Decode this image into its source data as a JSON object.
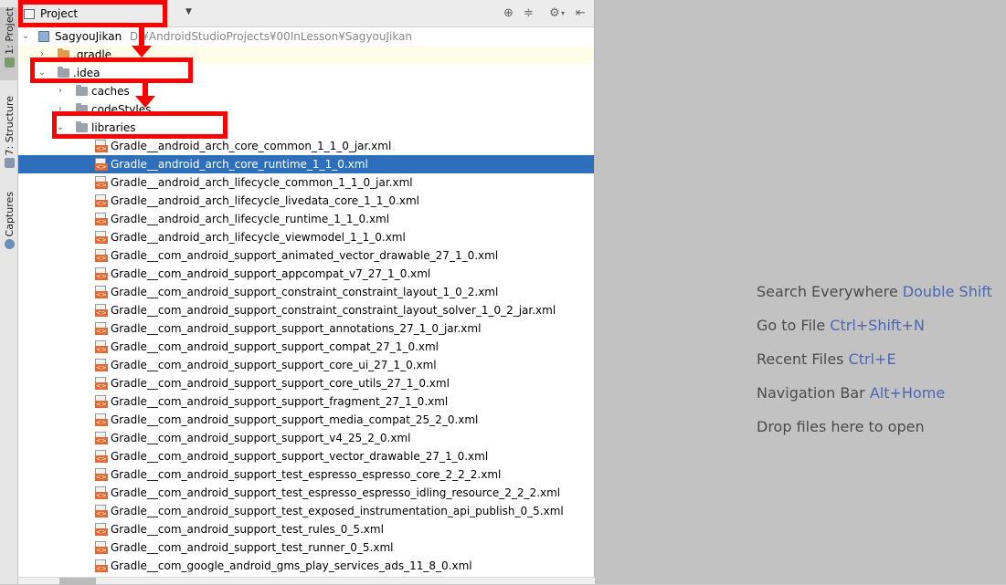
{
  "sidebar_tabs": [
    {
      "label": "1: Project"
    },
    {
      "label": "7: Structure"
    },
    {
      "label": "Captures"
    }
  ],
  "toolbar": {
    "view_label": "Project"
  },
  "tree": {
    "root": {
      "name": "SagyouJikan",
      "path": "D:¥AndroidStudioProjects¥00InLesson¥SagyouJikan"
    },
    "gradle": ".gradle",
    "idea": ".idea",
    "caches": "caches",
    "codestyles": "codeStyles",
    "libraries": "libraries",
    "files": [
      "Gradle__android_arch_core_common_1_1_0_jar.xml",
      "Gradle__android_arch_core_runtime_1_1_0.xml",
      "Gradle__android_arch_lifecycle_common_1_1_0_jar.xml",
      "Gradle__android_arch_lifecycle_livedata_core_1_1_0.xml",
      "Gradle__android_arch_lifecycle_runtime_1_1_0.xml",
      "Gradle__android_arch_lifecycle_viewmodel_1_1_0.xml",
      "Gradle__com_android_support_animated_vector_drawable_27_1_0.xml",
      "Gradle__com_android_support_appcompat_v7_27_1_0.xml",
      "Gradle__com_android_support_constraint_constraint_layout_1_0_2.xml",
      "Gradle__com_android_support_constraint_constraint_layout_solver_1_0_2_jar.xml",
      "Gradle__com_android_support_support_annotations_27_1_0_jar.xml",
      "Gradle__com_android_support_support_compat_27_1_0.xml",
      "Gradle__com_android_support_support_core_ui_27_1_0.xml",
      "Gradle__com_android_support_support_core_utils_27_1_0.xml",
      "Gradle__com_android_support_support_fragment_27_1_0.xml",
      "Gradle__com_android_support_support_media_compat_25_2_0.xml",
      "Gradle__com_android_support_support_v4_25_2_0.xml",
      "Gradle__com_android_support_support_vector_drawable_27_1_0.xml",
      "Gradle__com_android_support_test_espresso_espresso_core_2_2_2.xml",
      "Gradle__com_android_support_test_espresso_espresso_idling_resource_2_2_2.xml",
      "Gradle__com_android_support_test_exposed_instrumentation_api_publish_0_5.xml",
      "Gradle__com_android_support_test_rules_0_5.xml",
      "Gradle__com_android_support_test_runner_0_5.xml",
      "Gradle__com_google_android_gms_play_services_ads_11_8_0.xml"
    ],
    "selected_file": "Gradle__android_arch_core_runtime_1_1_0.xml"
  },
  "editor": {
    "hints": [
      {
        "text": "Search Everywhere",
        "shortcut": "Double Shift"
      },
      {
        "text": "Go to File",
        "shortcut": "Ctrl+Shift+N"
      },
      {
        "text": "Recent Files",
        "shortcut": "Ctrl+E"
      },
      {
        "text": "Navigation Bar",
        "shortcut": "Alt+Home"
      },
      {
        "text": "Drop files here to open",
        "shortcut": ""
      }
    ]
  },
  "colors": {
    "selection": "#2d6fbb",
    "annotation_red": "#ff0000",
    "shortcut_blue": "#4c67b2"
  }
}
